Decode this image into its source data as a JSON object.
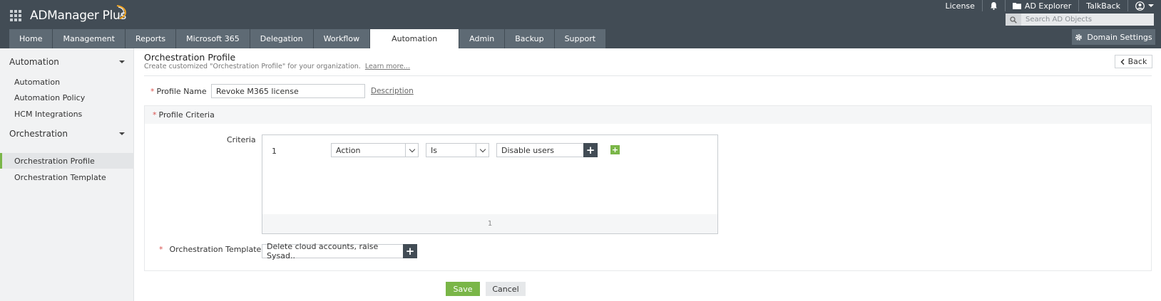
{
  "header": {
    "app_name": "ADManager Plus",
    "top_links": {
      "license": "License",
      "ad_explorer": "AD Explorer",
      "talkback": "TalkBack"
    },
    "search": {
      "placeholder": "Search AD Objects"
    },
    "tabs": [
      {
        "label": "Home",
        "active": false
      },
      {
        "label": "Management",
        "active": false
      },
      {
        "label": "Reports",
        "active": false
      },
      {
        "label": "Microsoft 365",
        "active": false
      },
      {
        "label": "Delegation",
        "active": false
      },
      {
        "label": "Workflow",
        "active": false
      },
      {
        "label": "Automation",
        "active": true
      },
      {
        "label": "Admin",
        "active": false
      },
      {
        "label": "Backup",
        "active": false
      },
      {
        "label": "Support",
        "active": false
      }
    ],
    "domain_settings_label": "Domain Settings"
  },
  "sidebar": {
    "sections": [
      {
        "title": "Automation",
        "items": [
          "Automation",
          "Automation Policy",
          "HCM Integrations"
        ]
      },
      {
        "title": "Orchestration",
        "items": [
          "Orchestration Profile",
          "Orchestration Template"
        ]
      }
    ],
    "active_item": "Orchestration Profile"
  },
  "main": {
    "title": "Orchestration Profile",
    "subtitle": "Create customized \"Orchestration Profile\" for your organization.",
    "learn_more": "Learn more...",
    "back_label": "Back",
    "profile_name_label": "Profile Name",
    "profile_name_value": "Revoke M365 license",
    "description_link": "Description",
    "profile_criteria_label": "Profile Criteria",
    "criteria_label": "Criteria",
    "criteria_row": {
      "index": "1",
      "field": "Action",
      "operator": "Is",
      "value": "Disable users"
    },
    "criteria_footer": "1",
    "orchestration_template_label": "Orchestration Template",
    "orchestration_template_value": "Delete cloud accounts, raise Sysad..",
    "save_label": "Save",
    "cancel_label": "Cancel"
  },
  "colors": {
    "header_bg": "#424c55",
    "tab_bg": "#5e6a74",
    "accent_green": "#7ab648",
    "required_red": "#d9534f"
  }
}
